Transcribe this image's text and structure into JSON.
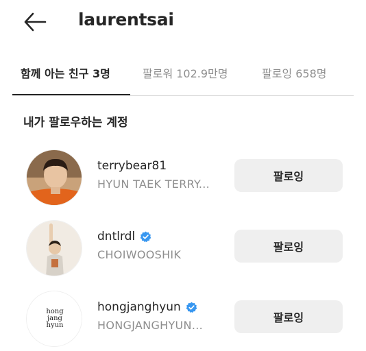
{
  "header": {
    "back_icon": "arrow-left-icon",
    "title": "laurentsai"
  },
  "tabs": [
    {
      "label": "함께 아는 친구 3명",
      "active": true
    },
    {
      "label": "팔로워 102.9만명",
      "active": false
    },
    {
      "label": "팔로잉 658명",
      "active": false
    }
  ],
  "section": {
    "title": "내가 팔로우하는 계정"
  },
  "accounts": [
    {
      "username": "terrybear81",
      "full_name": "HYUN TAEK TERRY...",
      "verified": false,
      "button_label": "팔로잉"
    },
    {
      "username": "dntlrdl",
      "full_name": "CHOIWOOSHIK",
      "verified": true,
      "button_label": "팔로잉"
    },
    {
      "username": "hongjanghyun",
      "full_name": "HONGJANGHYUN...",
      "verified": true,
      "button_label": "팔로잉"
    }
  ],
  "colors": {
    "text_primary": "#262626",
    "text_secondary": "#8e8e8e",
    "button_bg": "#efefef",
    "verified_blue": "#3897f0",
    "divider": "#dbdbdb"
  },
  "avatar_logo_text": [
    "hong",
    "jang",
    "hyun"
  ]
}
